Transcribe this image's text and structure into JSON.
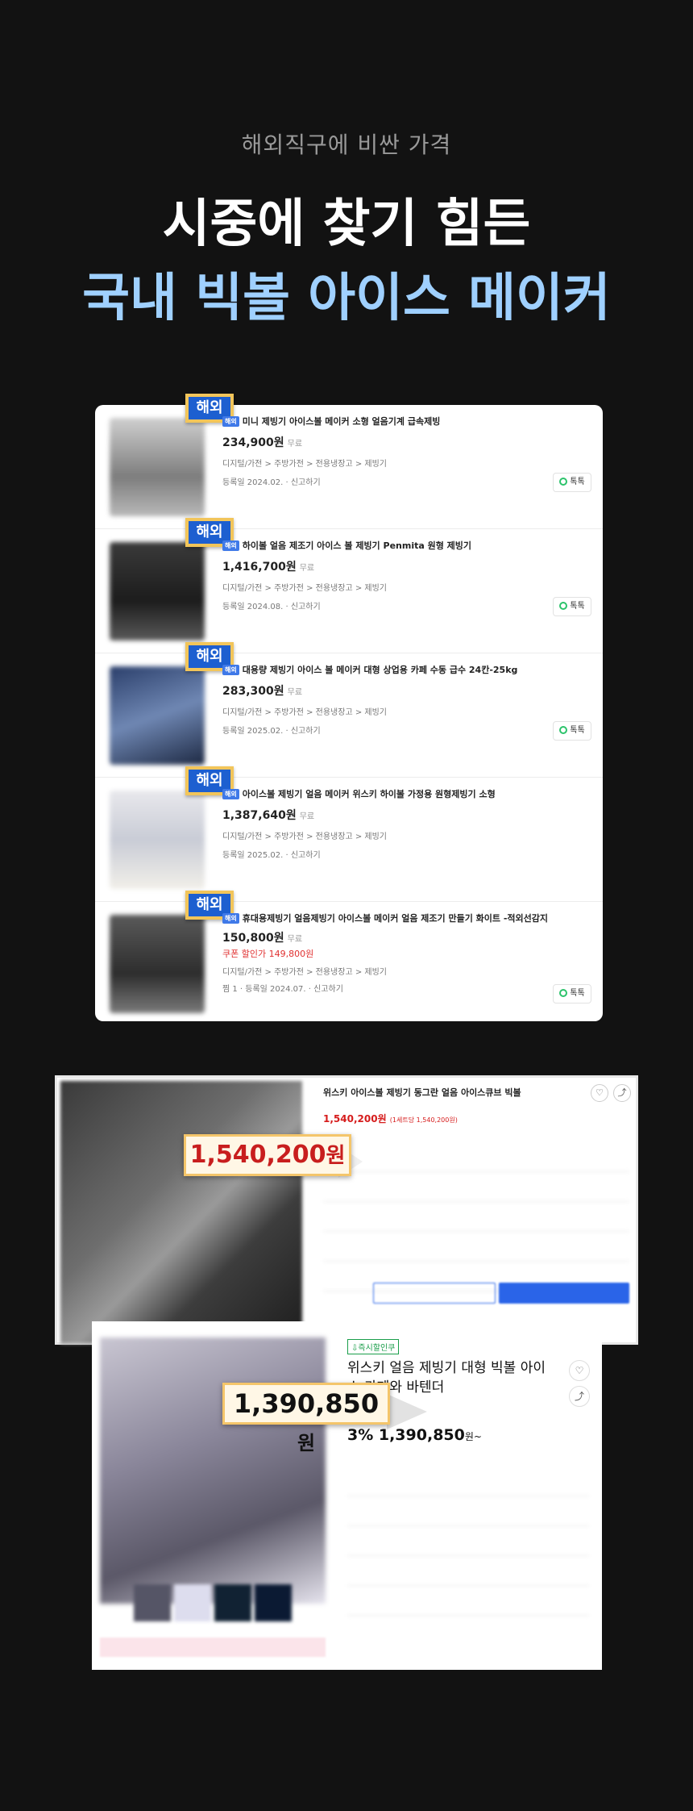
{
  "hero": {
    "kicker": "해외직구에 비싼 가격",
    "title_line1": "시중에 찾기 힘든",
    "title_line2": "국내 빅볼 아이스 메이커"
  },
  "listing": {
    "badge_label": "해외",
    "small_tag": "해외",
    "chat_label": "톡톡",
    "report_label": "신고하기",
    "shipping_label": "무료",
    "items": [
      {
        "title": "미니 제빙기 아이스볼 메이커 소형 얼음기계 급속제빙",
        "price": "234,900원",
        "category": "디지털/가전 > 주방가전 > 전용냉장고 > 제빙기",
        "date": "등록일 2024.02."
      },
      {
        "title": "하이볼 얼음 제조기 아이스 볼 제빙기 Penmita 원형 제빙기",
        "price": "1,416,700원",
        "category": "디지털/가전 > 주방가전 > 전용냉장고 > 제빙기",
        "date": "등록일 2024.08."
      },
      {
        "title": "대용량 제빙기 아이스 볼 메이커 대형 상업용 카페 수동 급수 24칸-25kg",
        "price": "283,300원",
        "category": "디지털/가전 > 주방가전 > 전용냉장고 > 제빙기",
        "date": "등록일 2025.02."
      },
      {
        "title": "아이스볼 제빙기 얼음 메이커 위스키 하이볼 가정용 원형제빙기 소형",
        "price": "1,387,640원",
        "category": "디지털/가전 > 주방가전 > 전용냉장고 > 제빙기",
        "date": "등록일 2025.02."
      },
      {
        "title": "휴대용제빙기 얼음제빙기 아이스볼 메이커 얼음 제조기 만들기 화이트 -적외선감지",
        "price": "150,800원",
        "coupon": "쿠폰 할인가 149,800원",
        "category": "디지털/가전 > 주방가전 > 전용냉장고 > 제빙기",
        "date": "찜 1 · 등록일 2024.07."
      }
    ]
  },
  "shot1": {
    "title": "위스키 아이스볼 제빙기 동그란 얼음 아이스큐브 빅볼",
    "price": "1,540,200원",
    "price_note": "(1세트당 1,540,200원)",
    "callout_number": "1,540,200",
    "callout_unit": "원"
  },
  "shot2": {
    "tag": "⇩즉시할인쿠",
    "title": "위스키 얼음 제빙기 대형 빅볼 아이스 카페와 바텐더",
    "price_prefix": "3% 1,390,850",
    "price_unit": "원~",
    "callout_number": "1,390,850",
    "callout_unit": "원"
  },
  "colors": {
    "background": "#121212",
    "accent_blue_title": "#9fd0ff",
    "badge_blue": "#1d5fd0",
    "badge_border": "#f2c55a",
    "price_red": "#d61c1c"
  }
}
